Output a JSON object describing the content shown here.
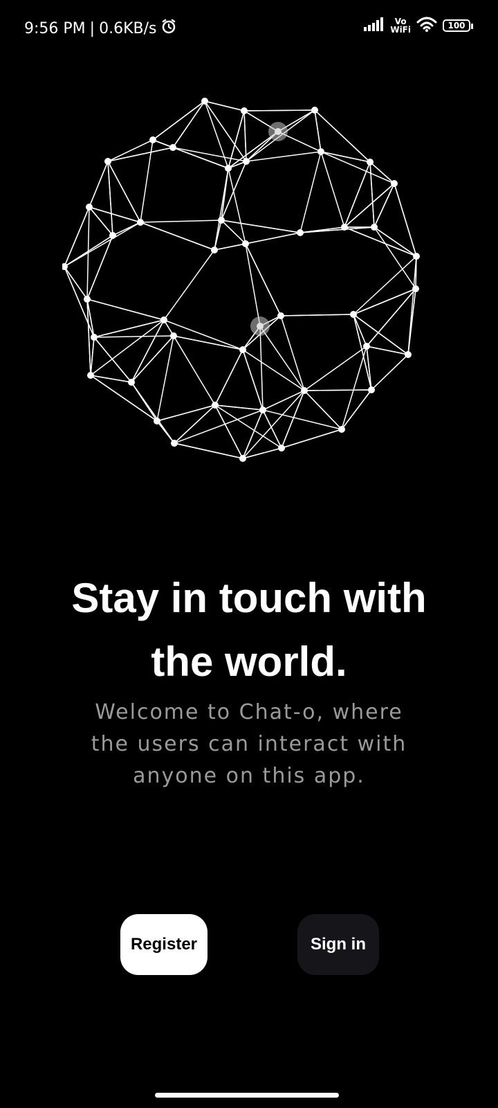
{
  "status_bar": {
    "time": "9:56 PM",
    "separator": "|",
    "speed": "0.6KB/s",
    "vo_top": "Vo",
    "vo_bottom": "WiFi",
    "battery": "100"
  },
  "hero": {
    "title_line1": "Stay in touch with",
    "title_line2": "the world.",
    "sub_line1": "Welcome to Chat-o, where",
    "sub_line2": "the users can interact with",
    "sub_line3": "anyone on this app."
  },
  "buttons": {
    "register": "Register",
    "signin": "Sign in"
  }
}
